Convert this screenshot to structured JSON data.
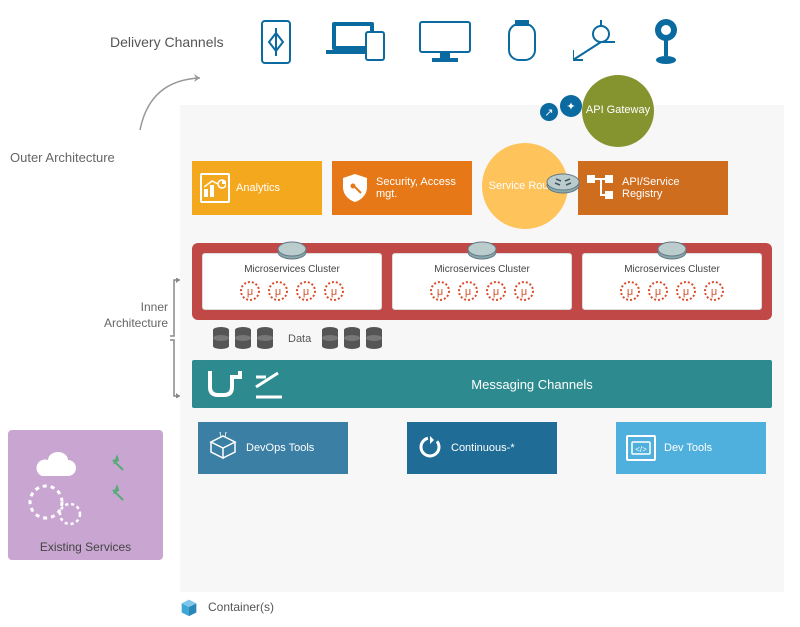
{
  "delivery_label": "Delivery Channels",
  "outer_arch_label": "Outer Architecture",
  "inner_arch_label_l1": "Inner",
  "inner_arch_label_l2": "Architecture",
  "api_gateway": "API Gateway",
  "tier1": {
    "analytics": "Analytics",
    "security": "Security, Access mgt.",
    "service_router": "Service Router",
    "registry": "API/Service Registry"
  },
  "cluster_title": "Microservices Cluster",
  "mu_glyph": "μ",
  "data_label": "Data",
  "messaging_label": "Messaging Channels",
  "bottom": {
    "devops": "DevOps Tools",
    "continuous": "Continuous-*",
    "devtools": "Dev Tools"
  },
  "existing_label": "Existing Services",
  "containers_label": "Container(s)",
  "colors": {
    "blue": "#0b6a9f",
    "olive": "#86942f",
    "orange1": "#f4a81d",
    "orange2": "#e67817",
    "orange3": "#fec35b",
    "orange4": "#cf6d1e",
    "red": "#c04846",
    "teal": "#2d8a8f",
    "blue2": "#3b7fa5",
    "blue3": "#1f6d96",
    "blue4": "#4fb0dd",
    "purple": "#c9a6d1"
  }
}
